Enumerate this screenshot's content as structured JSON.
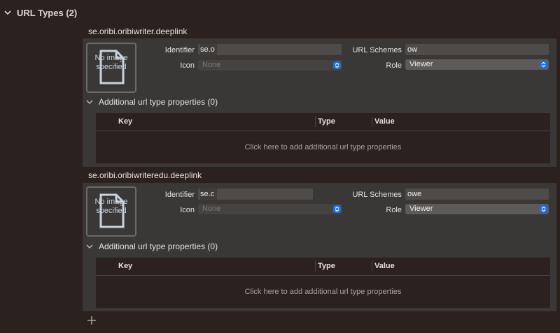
{
  "section": {
    "title": "URL Types (2)"
  },
  "labels": {
    "identifier": "Identifier",
    "icon": "Icon",
    "url_schemes": "URL Schemes",
    "role": "Role",
    "additional": "Additional url type properties (0)",
    "col_key": "Key",
    "col_type": "Type",
    "col_value": "Value",
    "add_hint": "Click here to add additional url type properties",
    "no_image": "No image specified"
  },
  "entries": [
    {
      "title": "se.oribi.oribiwriter.deeplink",
      "identifier": "se.o",
      "icon": "None",
      "url_schemes": "ow",
      "role": "Viewer"
    },
    {
      "title": "se.oribi.oribiwriteredu.deeplink",
      "identifier": "se.c",
      "icon": "None",
      "url_schemes": "owe",
      "role": "Viewer"
    }
  ],
  "colors": {
    "background": "#2b211e",
    "panel": "#3a3836",
    "accent": "#1f6fe6"
  }
}
